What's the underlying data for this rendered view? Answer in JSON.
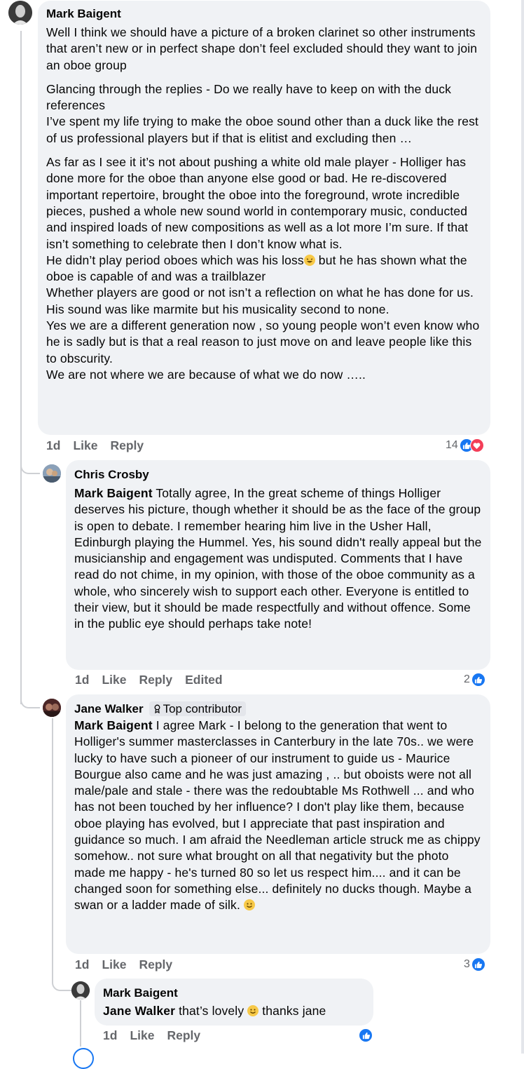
{
  "comments": {
    "c1": {
      "author": "Mark Baigent",
      "paragraphs": [
        "Well I think we should have a picture of a broken clarinet so other instruments that aren’t new or in perfect shape don’t feel excluded should they want to join an oboe group",
        "Glancing through the replies - Do we really have to keep on with the duck references\nI’ve spent my life trying to make the oboe sound other than a duck like the rest of us professional players but if that is elitist and excluding then …",
        "As far as I see it it’s not about pushing a white old male player - Holliger has done more for the oboe than anyone else good or bad. He re-discovered important repertoire, brought the oboe into the foreground, wrote incredible pieces, pushed a whole new sound world in contemporary music, conducted and inspired loads of new compositions as well as a lot more I’m sure. If that isn’t something to celebrate then I don’t know what is."
      ],
      "p4a": "He didn’t play period oboes which was his loss",
      "p4b": " but he has shown what the oboe is capable of and was a trailblazer\nWhether players are good or not isn’t a reflection on what he has done for us.\nHis sound was like marmite but his musicality second to none.\nYes we are a different generation now , so young people won’t even know who he is sadly but is that a real reason to just move on and leave people like this to obscurity.\nWe are not where we are because of what we do now …..",
      "time": "1d",
      "like": "Like",
      "reply": "Reply",
      "reactions": "14"
    },
    "c2": {
      "author": "Chris Crosby",
      "mention": "Mark Baigent",
      "text": " Totally agree, In the great scheme of things Holliger deserves his picture, though whether it should be as the face of the group is open to debate. I remember hearing him live in the Usher Hall, Edinburgh playing the Hummel. Yes, his sound didn't really appeal but the musicianship and engagement was undisputed. Comments that I have read do not chime, in my opinion, with those of the oboe community as a whole, who sincerely wish to support each other. Everyone is entitled to their view, but it should be made respectfully and without offence. Some in the public eye should perhaps take note!",
      "time": "1d",
      "like": "Like",
      "reply": "Reply",
      "edited": "Edited",
      "reactions": "2"
    },
    "c3": {
      "author": "Jane Walker",
      "badge": "Top contributor",
      "mention": "Mark Baigent",
      "text": " I agree Mark - I belong to the generation that went to Holliger's summer masterclasses in Canterbury in the late 70s.. we were lucky to have such a pioneer of our instrument to guide us - Maurice Bourgue also came and he was just amazing , .. but oboists were not all male/pale and stale - there was the redoubtable Ms Rothwell ... and who has not been touched by her influence? I don't play like them, because oboe playing has evolved, but I appreciate that past inspiration and guidance so much. I am afraid the Needleman article struck me as chippy somehow.. not sure what brought on all that negativity but the photo made me happy - he's turned 80 so let us respect him.... and it can be changed soon for something else... definitely no ducks though. Maybe a swan or a ladder made of silk. ",
      "time": "1d",
      "like": "Like",
      "reply": "Reply",
      "reactions": "3"
    },
    "c4": {
      "author": "Mark Baigent",
      "mention": "Jane Walker",
      "text_a": " that’s lovely ",
      "text_b": " thanks jane",
      "time": "1d",
      "like": "Like",
      "reply": "Reply"
    }
  },
  "colors": {
    "like": "#1877f2",
    "love": "#f33e58",
    "bubble": "#f0f2f5",
    "meta": "#65676b"
  },
  "icons": [
    "like-icon",
    "love-icon",
    "top-contributor-icon",
    "smile-emoji"
  ]
}
